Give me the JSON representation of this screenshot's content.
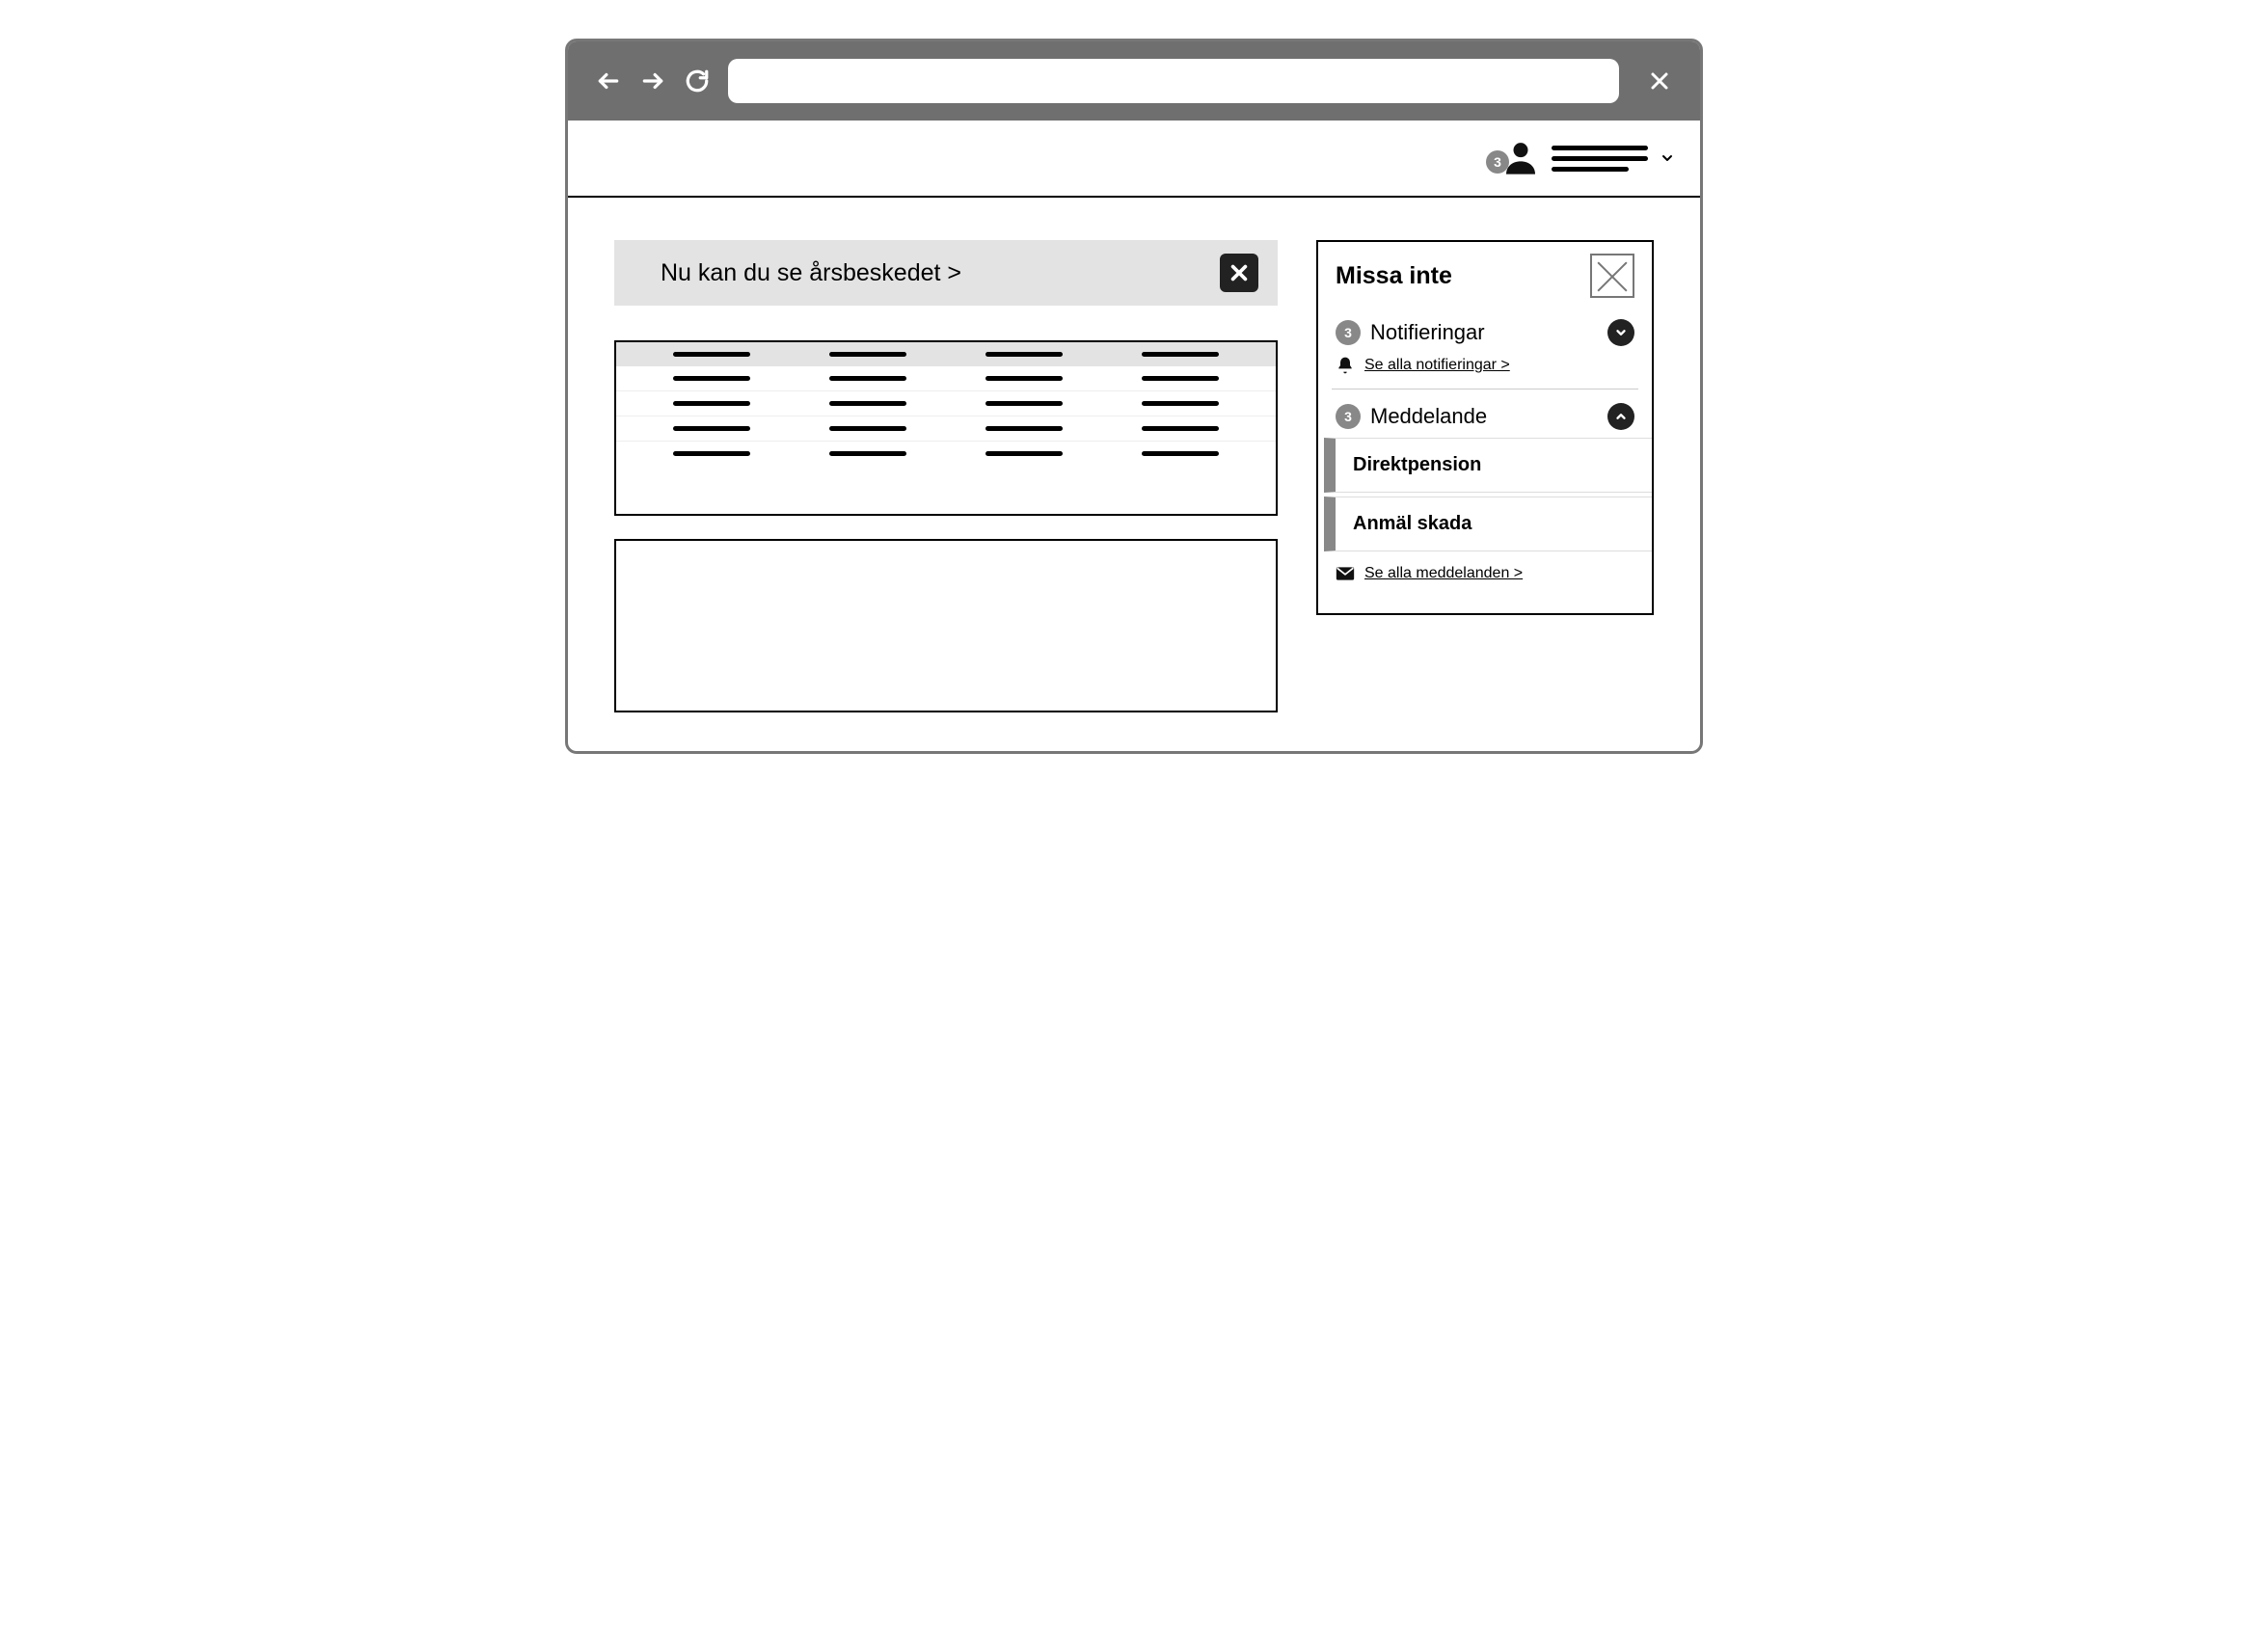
{
  "browser": {
    "url": ""
  },
  "header": {
    "user_badge_count": "3"
  },
  "banner": {
    "text": "Nu kan du se årsbeskedet >"
  },
  "side_panel": {
    "title": "Missa inte",
    "notifications": {
      "count": "3",
      "label": "Notifieringar",
      "see_all": "Se alla notifieringar >"
    },
    "messages": {
      "count": "3",
      "label": "Meddelande",
      "items": [
        "Direktpension",
        "Anmäl skada"
      ],
      "see_all": "Se alla meddelanden >"
    }
  }
}
